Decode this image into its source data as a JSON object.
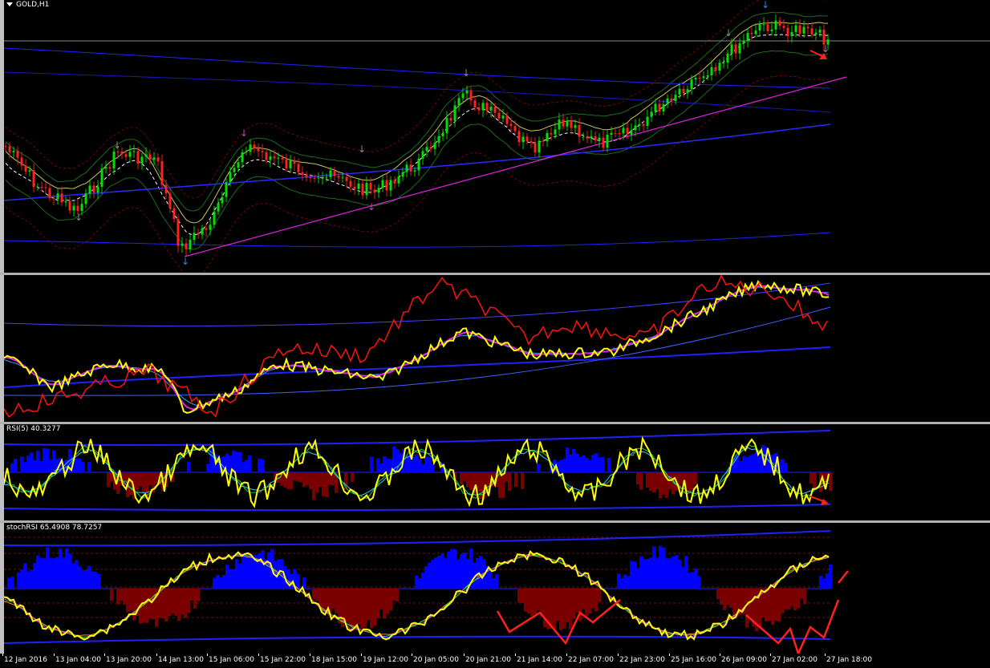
{
  "window": {
    "title": "GOLD,H1"
  },
  "panes": {
    "rsi": {
      "label": "RSI(5) 40.3277"
    },
    "stoch": {
      "label": "stochRSI 65.4908 78.7257"
    }
  },
  "time_axis": [
    "12 Jan 2016",
    "13 Jan 04:00",
    "13 Jan 20:00",
    "14 Jan 13:00",
    "15 Jan 06:00",
    "15 Jan 22:00",
    "18 Jan 15:00",
    "19 Jan 12:00",
    "20 Jan 05:00",
    "20 Jan 21:00",
    "21 Jan 14:00",
    "22 Jan 07:00",
    "22 Jan 23:00",
    "25 Jan 16:00",
    "26 Jan 09:00",
    "27 Jan 02:00",
    "27 Jan 18:00"
  ],
  "colors": {
    "bull": "#00e000",
    "bear": "#ff2020",
    "trend": "#ff00ff",
    "band": "#1a1aff",
    "rsi": "#ffff00",
    "arrow": "#ff2020",
    "hist_up": "#0000ff",
    "hist_down": "#7a0000"
  }
}
